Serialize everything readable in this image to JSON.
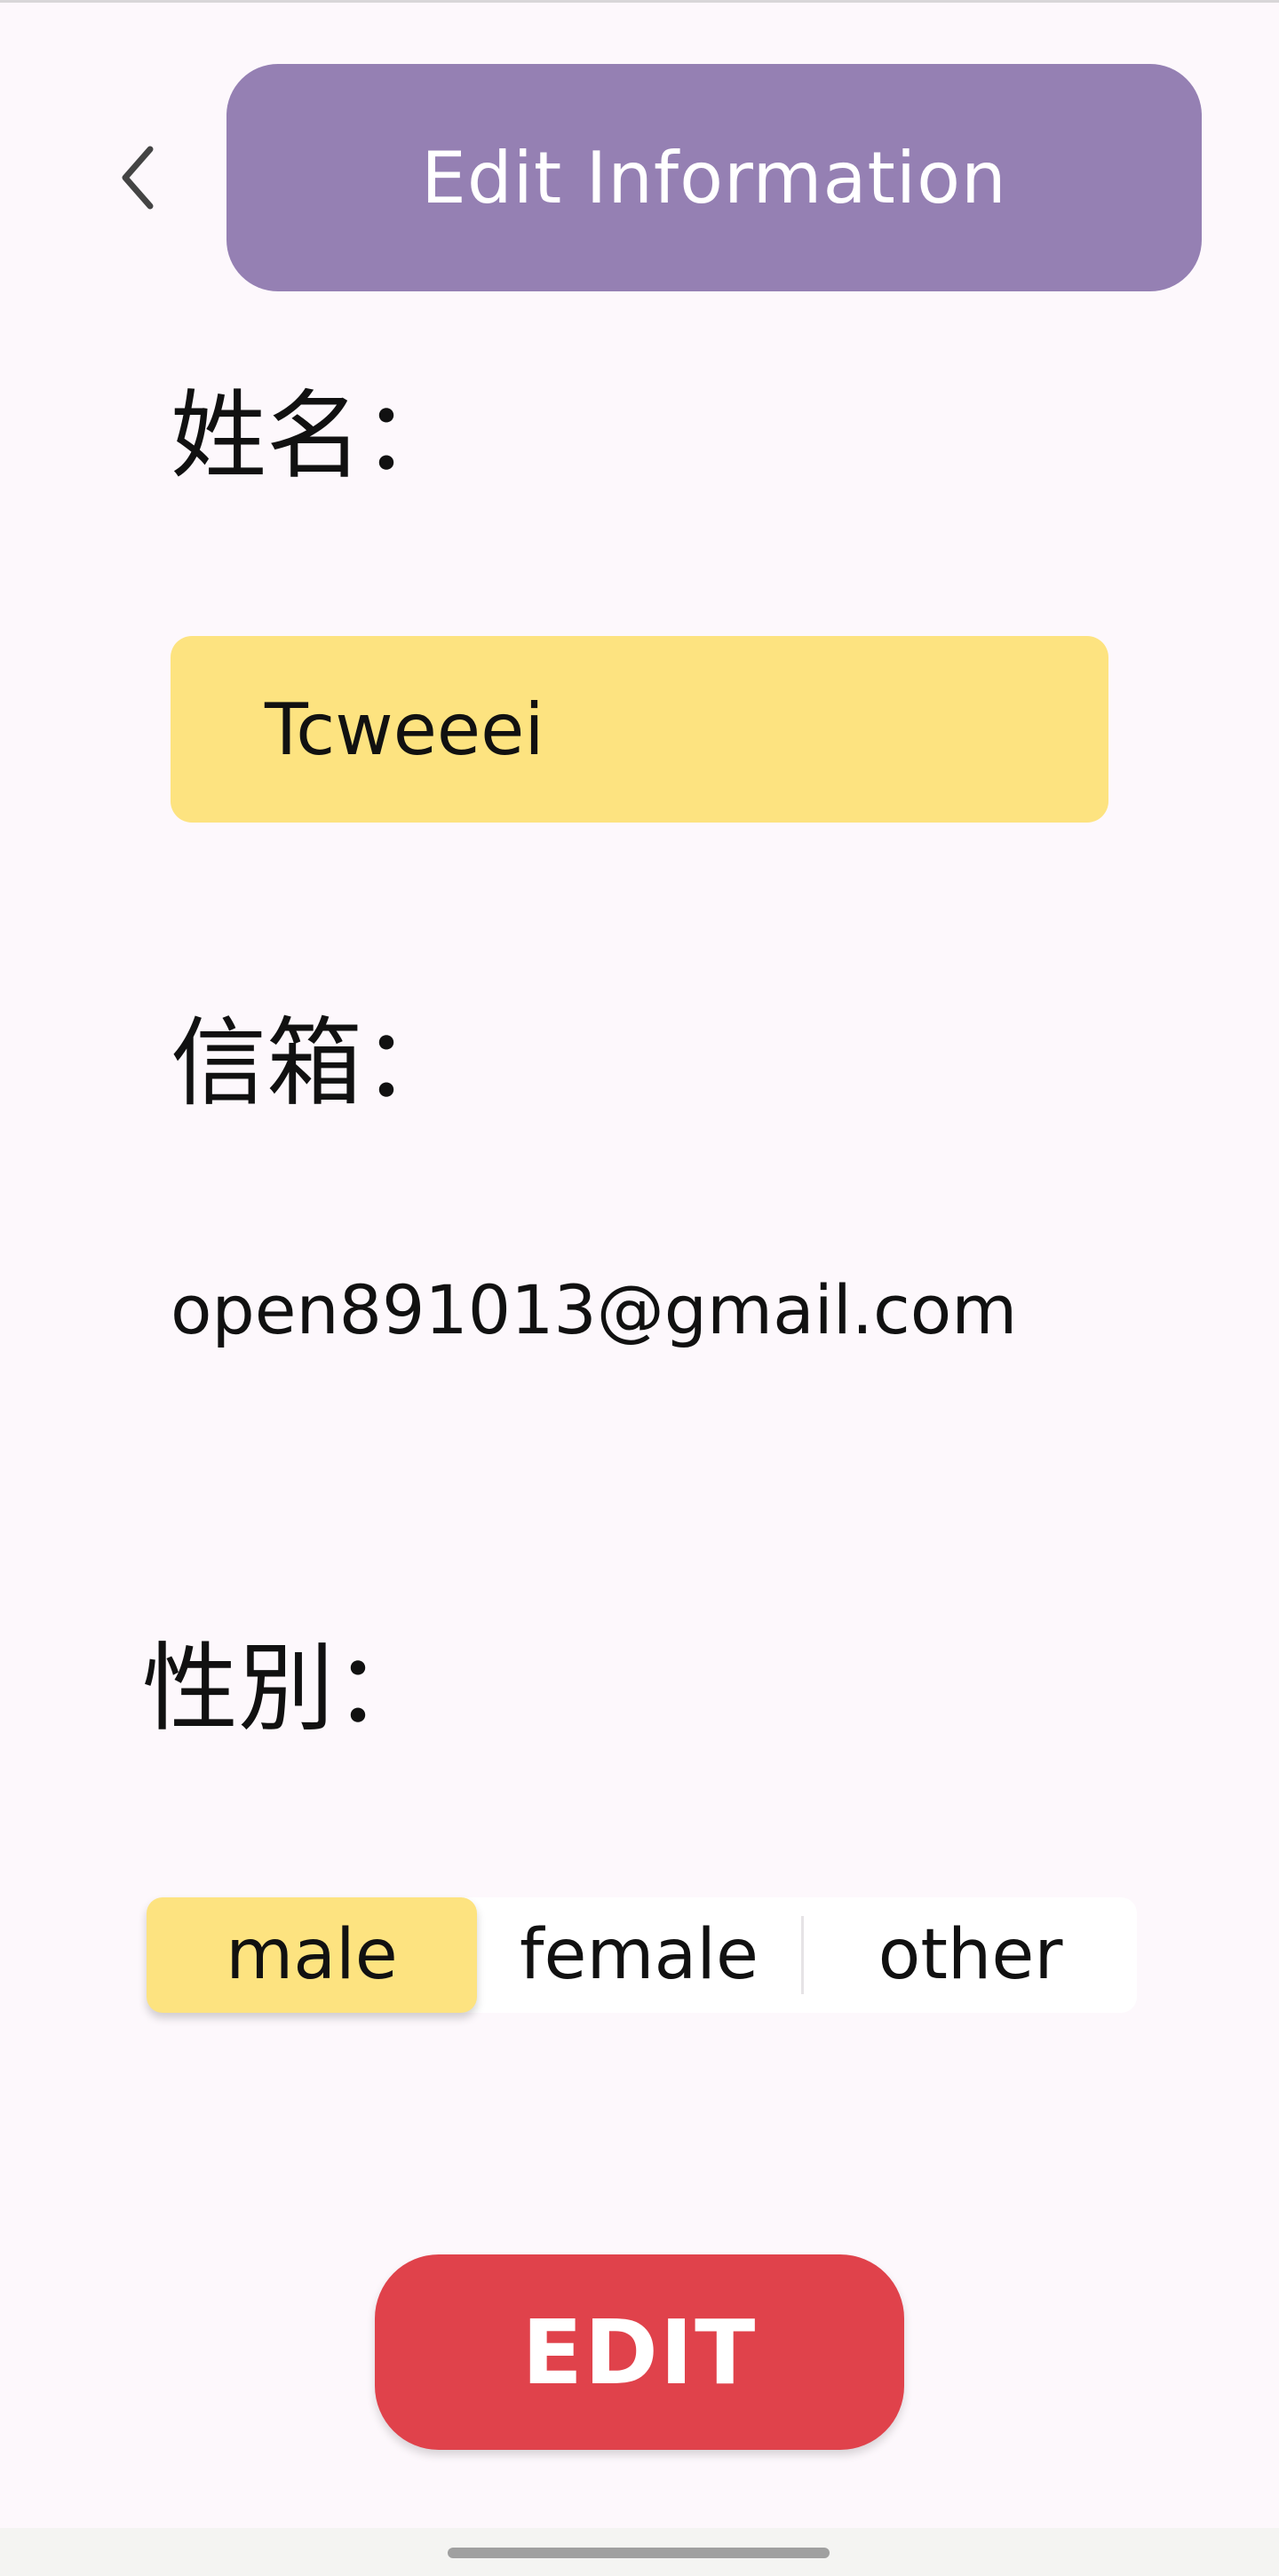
{
  "header": {
    "title": "Edit Information",
    "back_icon": "chevron-left-icon",
    "background_color": "#9580b3"
  },
  "form": {
    "name_label": "姓名：",
    "name_value": "Tcweeei",
    "email_label": "信箱：",
    "email_value": "open891013@gmail.com",
    "gender_label": "性別：",
    "gender_options": [
      "male",
      "female",
      "other"
    ],
    "gender_selected": "male",
    "field_color": "#fde380"
  },
  "actions": {
    "edit_label": "EDIT",
    "edit_color": "#e0424b"
  }
}
